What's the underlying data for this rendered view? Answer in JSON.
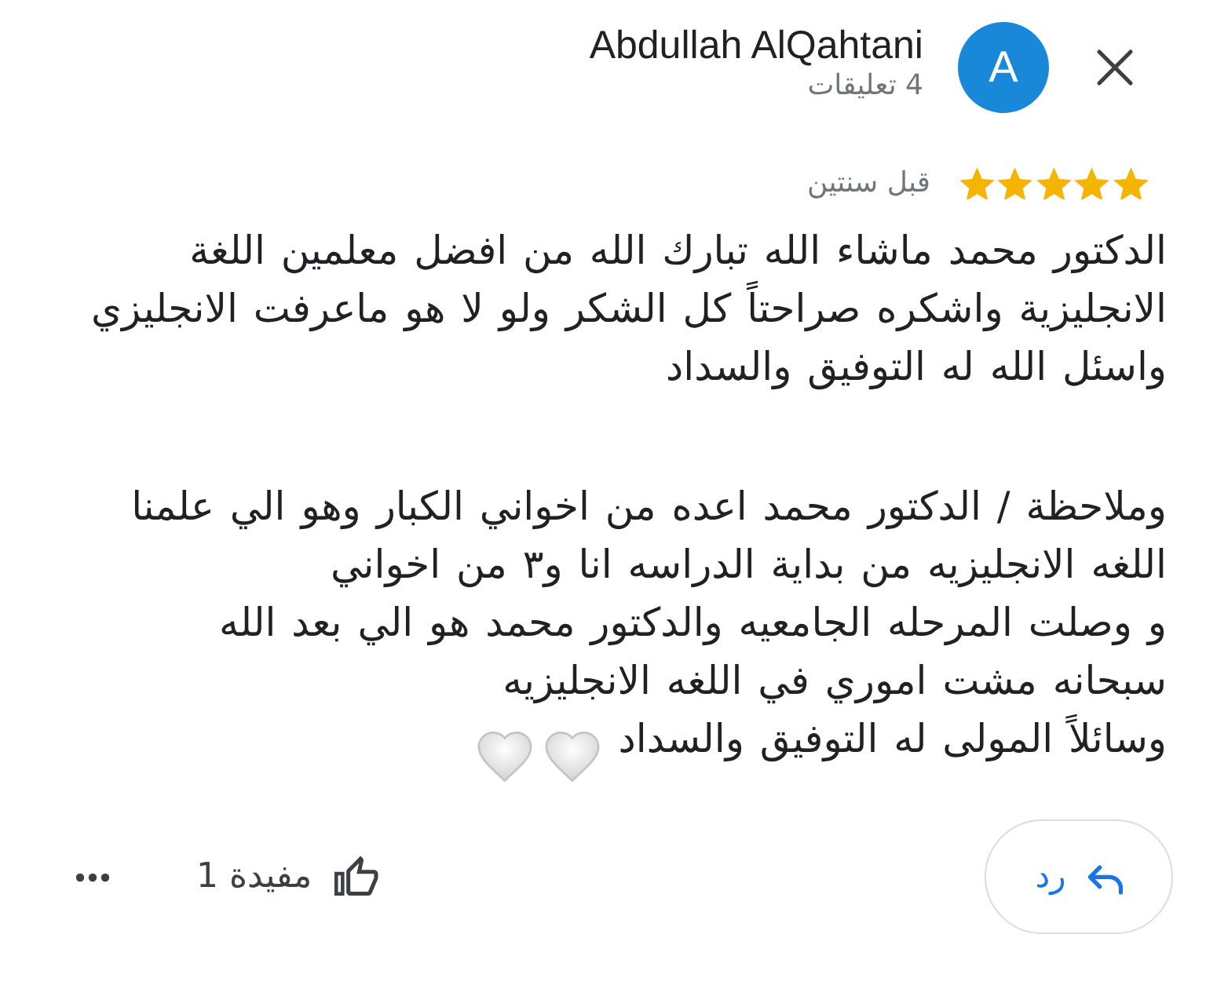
{
  "header": {
    "author": "Abdullah AlQahtani",
    "review_count": "4 تعليقات",
    "avatar_letter": "A"
  },
  "rating": {
    "stars": 5,
    "time": "قبل سنتين"
  },
  "review": {
    "paragraphs": [
      "الدكتور محمد ماشاء الله تبارك الله من افضل معلمين اللغة\nالانجليزية واشكره صراحتاً كل الشكر ولو لا هو ماعرفت الانجليزي\nواسئل الله له التوفيق والسداد",
      "وملاحظة / الدكتور محمد اعده من اخواني الكبار وهو الي علمنا\nاللغه الانجليزيه من بداية الدراسه انا و٣ من اخواني\nو وصلت المرحله الجامعيه والدكتور محمد هو الي بعد الله\nسبحانه مشت اموري في اللغه الانجليزيه"
    ],
    "closing": "وسائلاً المولى له التوفيق والسداد"
  },
  "actions": {
    "reply": "رد",
    "helpful": "مفيدة 1"
  }
}
